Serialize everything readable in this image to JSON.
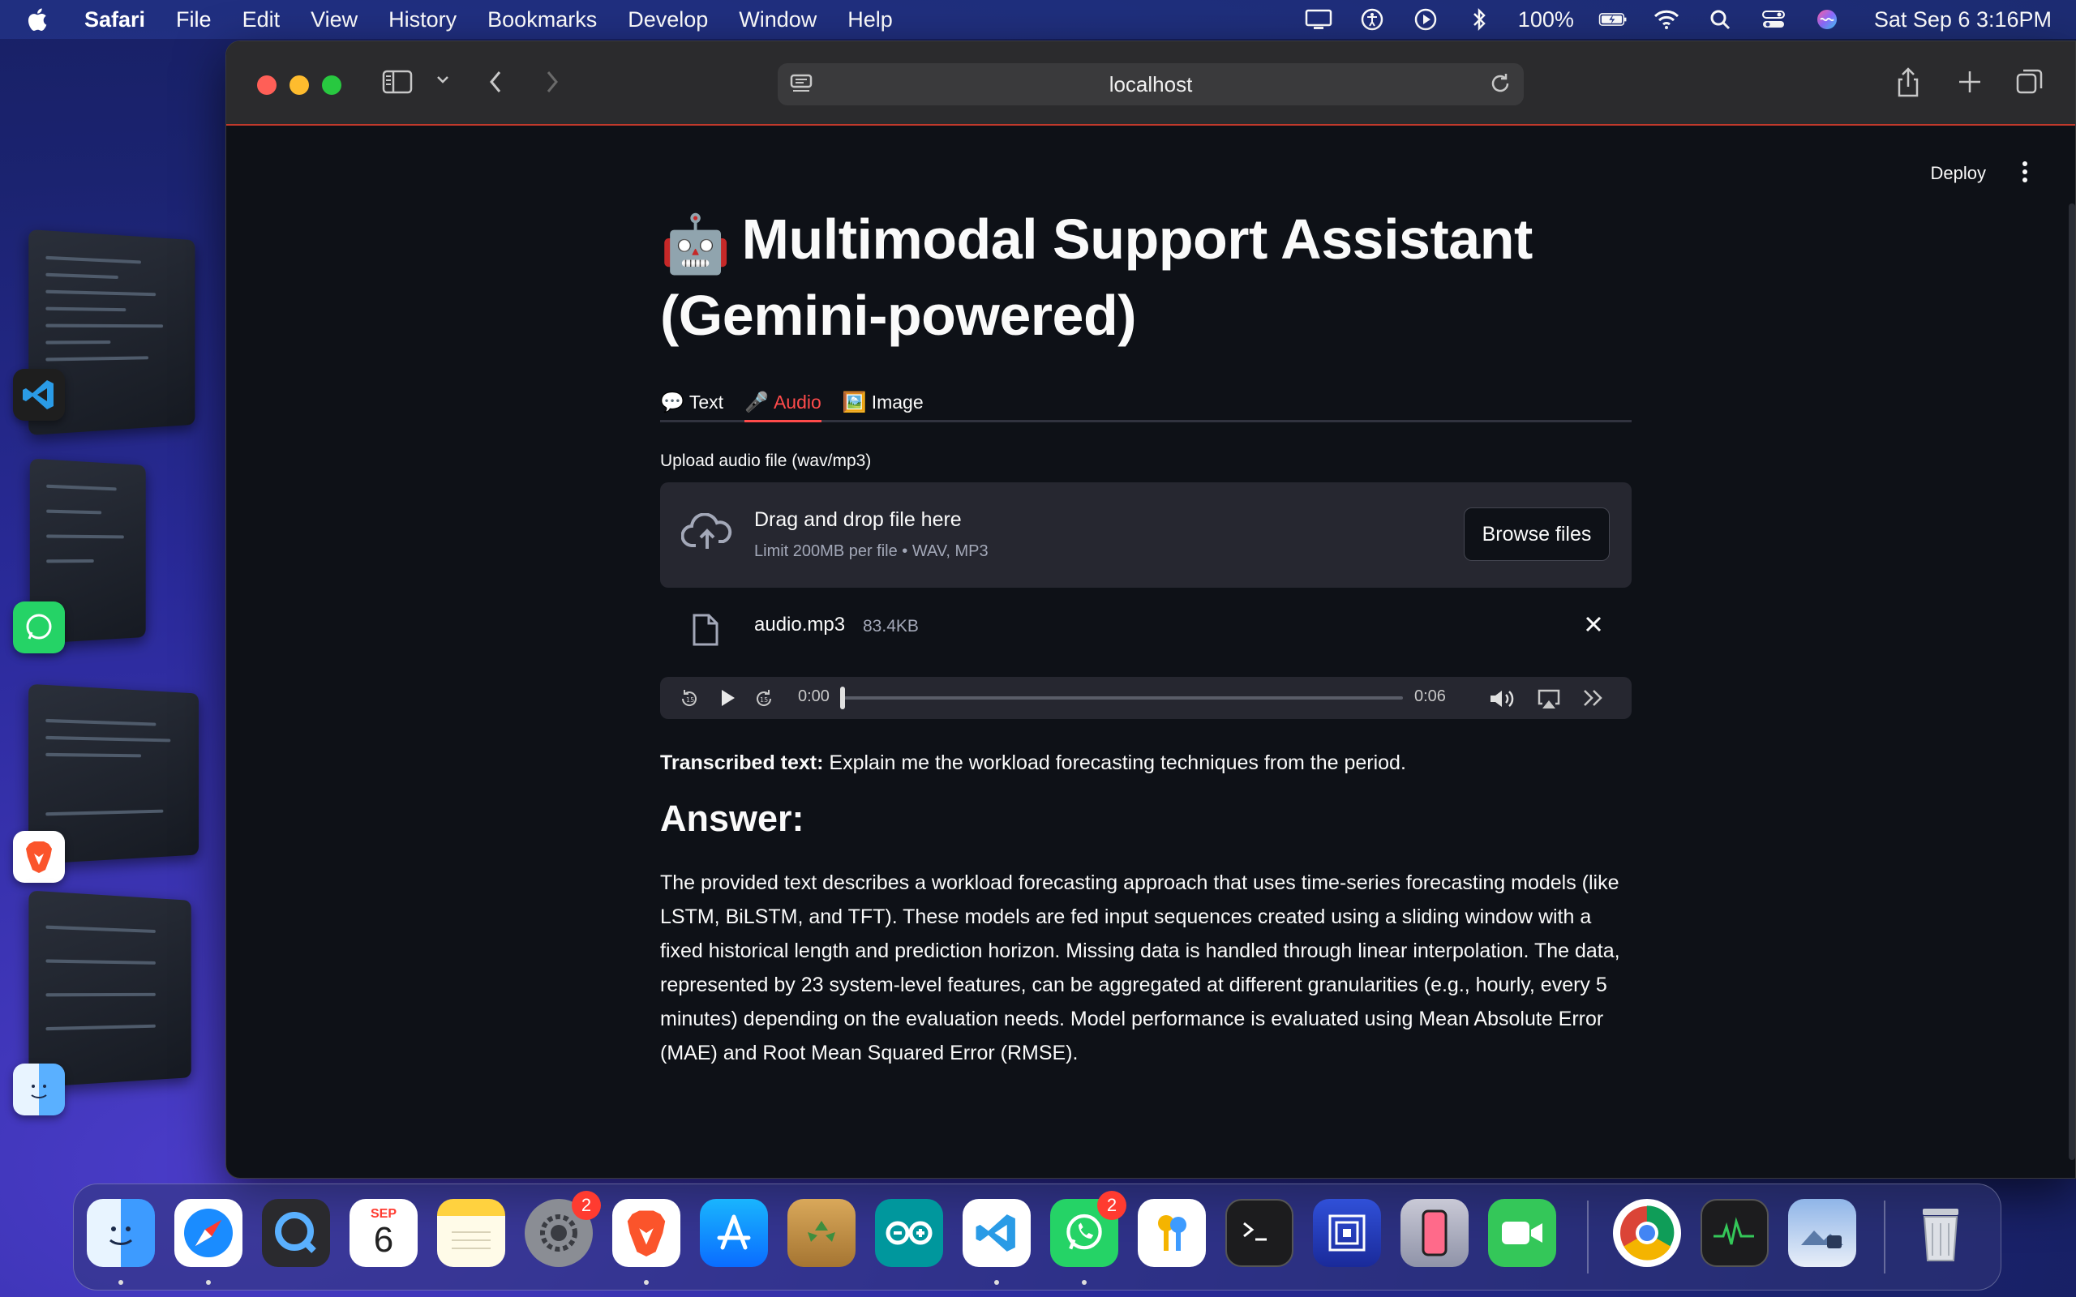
{
  "menubar": {
    "app_name": "Safari",
    "items": [
      "File",
      "Edit",
      "View",
      "History",
      "Bookmarks",
      "Develop",
      "Window",
      "Help"
    ],
    "battery": "100%",
    "clock": "Sat Sep 6  3:16PM"
  },
  "browser": {
    "url": "localhost"
  },
  "app": {
    "deploy_label": "Deploy",
    "title_emoji": "🤖",
    "title": "Multimodal Support Assistant (Gemini-powered)",
    "tabs": [
      {
        "emoji": "💬",
        "label": "Text",
        "active": false
      },
      {
        "emoji": "🎤",
        "label": "Audio",
        "active": true
      },
      {
        "emoji": "🖼️",
        "label": "Image",
        "active": false
      }
    ],
    "upload_label": "Upload audio file (wav/mp3)",
    "dropzone": {
      "title": "Drag and drop file here",
      "subtitle": "Limit 200MB per file • WAV, MP3",
      "browse_label": "Browse files"
    },
    "file": {
      "name": "audio.mp3",
      "size": "83.4KB"
    },
    "player": {
      "current_time": "0:00",
      "duration": "0:06",
      "progress": 0
    },
    "transcribed_label": "Transcribed text:",
    "transcribed_text": "Explain me the workload forecasting techniques from the period.",
    "answer_heading": "Answer:",
    "answer_text": "The provided text describes a workload forecasting approach that uses time-series forecasting models (like LSTM, BiLSTM, and TFT). These models are fed input sequences created using a sliding window with a fixed historical length and prediction horizon. Missing data is handled through linear interpolation. The data, represented by 23 system-level features, can be aggregated at different granularities (e.g., hourly, every 5 minutes) depending on the evaluation needs. Model performance is evaluated using Mean Absolute Error (MAE) and Root Mean Squared Error (RMSE)."
  },
  "dock": {
    "calendar_month": "SEP",
    "calendar_day": "6",
    "settings_badge": "2",
    "whatsapp_badge": "2",
    "apps": [
      "finder-icon",
      "safari-icon",
      "quicktime-icon",
      "calendar-icon",
      "notes-icon",
      "system-settings-icon",
      "brave-icon",
      "app-store-icon",
      "recycle-icon",
      "arduino-icon",
      "vscode-icon",
      "whatsapp-icon",
      "keychain-icon",
      "terminal-icon",
      "screen-icon",
      "iphone-mirroring-icon",
      "facetime-icon",
      "chrome-icon",
      "activity-monitor-icon",
      "preview-icon",
      "trash-icon"
    ]
  },
  "colors": {
    "accent": "#ff4b4b",
    "app_bg": "#0e1117",
    "secondary_bg": "#262730"
  }
}
